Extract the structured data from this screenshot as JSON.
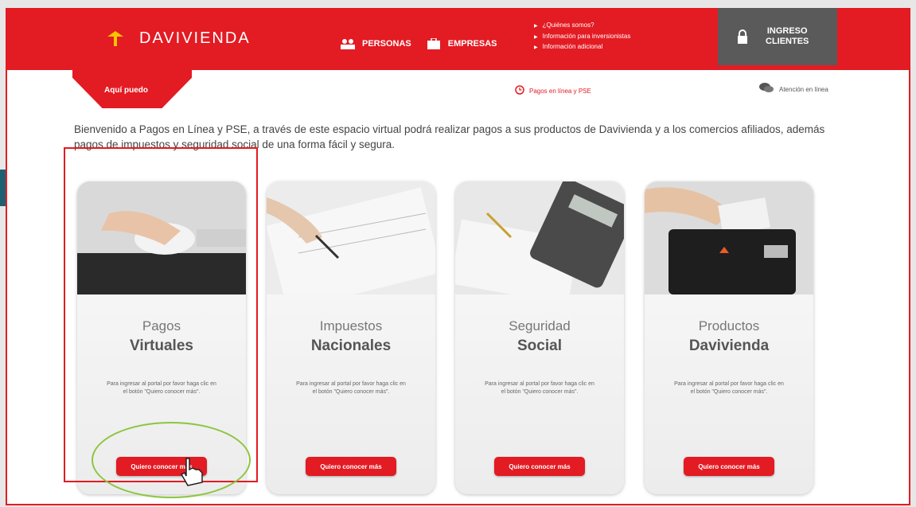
{
  "brand": {
    "name": "DAVIVIENDA"
  },
  "nav": {
    "personas": "PERSONAS",
    "empresas": "EMPRESAS"
  },
  "info_links": [
    "¿Quiénes somos?",
    "Información para inversionistas",
    "Información adicional"
  ],
  "login": {
    "line1": "INGRESO",
    "line2": "CLIENTES"
  },
  "subnav": {
    "aqui": "Aquí puedo",
    "pagos": "Pagos en línea y PSE",
    "atencion": "Atención en línea"
  },
  "intro": "Bienvenido a Pagos en Línea y PSE, a través de este espacio virtual podrá realizar pagos a sus productos de Davivienda y a los comercios afiliados, además pagos de impuestos y seguridad social de una forma fácil y segura.",
  "cards": [
    {
      "title_light": "Pagos",
      "title_bold": "Virtuales",
      "desc": "Para ingresar al portal por favor haga clic en el botón \"Quiero conocer más\".",
      "button": "Quiero conocer más"
    },
    {
      "title_light": "Impuestos",
      "title_bold": "Nacionales",
      "desc": "Para ingresar al portal por favor haga clic en el botón \"Quiero conocer más\".",
      "button": "Quiero conocer más"
    },
    {
      "title_light": "Seguridad",
      "title_bold": "Social",
      "desc": "Para ingresar al portal por favor haga clic en el botón \"Quiero conocer más\".",
      "button": "Quiero conocer más"
    },
    {
      "title_light": "Productos",
      "title_bold": "Davivienda",
      "desc": "Para ingresar al portal por favor haga clic en el botón \"Quiero conocer más\".",
      "button": "Quiero conocer más"
    }
  ],
  "colors": {
    "brand_red": "#e31b23",
    "login_gray": "#5a5a5a",
    "arrow_teal": "#1f5f72",
    "oval_green": "#8cc63f"
  },
  "icons": {
    "logo": "house-roof-icon",
    "personas": "people-icon",
    "empresas": "briefcase-icon",
    "login": "lock-icon",
    "pagos": "clock-icon",
    "atencion": "chat-bubble-icon",
    "arrow": "arrow-right-icon",
    "cursor": "hand-pointer-icon"
  }
}
